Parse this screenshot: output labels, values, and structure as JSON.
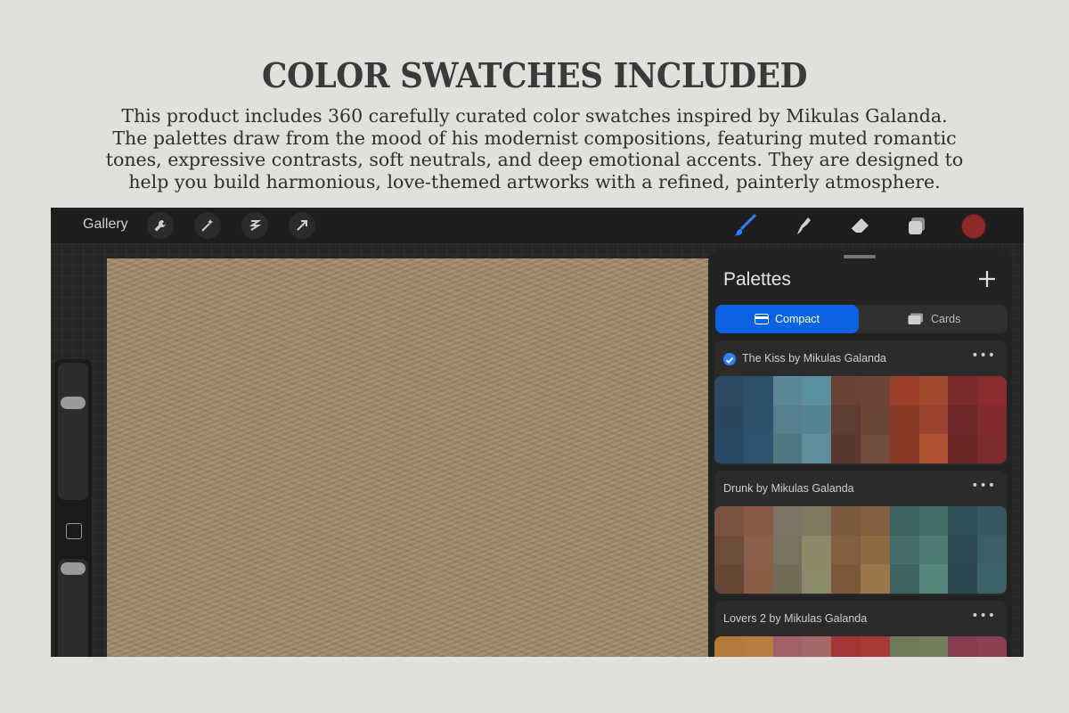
{
  "headline": "COLOR SWATCHES INCLUDED",
  "description_lines": [
    "This product includes 360 carefully curated color swatches inspired by Mikulas Galanda.",
    "The palettes draw from the mood of his modernist compositions, featuring muted romantic",
    "tones, expressive contrasts, soft neutrals, and deep emotional accents. They are designed to",
    "help you build harmonious, love-themed artworks with a refined, painterly atmosphere."
  ],
  "app": {
    "gallery_label": "Gallery",
    "toolbar_icons": [
      "wrench-icon",
      "magic-wand-icon",
      "selection-icon",
      "transform-arrow-icon"
    ],
    "right_tools": [
      "brush-icon",
      "smudge-icon",
      "eraser-icon",
      "layers-icon"
    ],
    "current_color": "#8c2a27"
  },
  "palettes_panel": {
    "title": "Palettes",
    "add_label": "+",
    "tabs": {
      "compact": "Compact",
      "cards": "Cards"
    },
    "more_label": "•••",
    "palettes": [
      {
        "name": "The Kiss by Mikulas Galanda",
        "selected": true,
        "colors": [
          "#2b4a63",
          "#2d5068",
          "#5c8895",
          "#5a909e",
          "#6a4238",
          "#6c4438",
          "#9b3f2a",
          "#a04a2e",
          "#7b2a2e",
          "#8a2c30",
          "#284861",
          "#2e526a",
          "#557f8c",
          "#54848f",
          "#5e3d34",
          "#6b4739",
          "#8c3a28",
          "#9a4430",
          "#70262a",
          "#7f2a2e",
          "#284a64",
          "#2f556e",
          "#4f7782",
          "#5f8e9a",
          "#5a3830",
          "#6f4b3d",
          "#8a3a27",
          "#ad5232",
          "#6a2428",
          "#7e2b2f"
        ]
      },
      {
        "name": "Drunk by Mikulas Galanda",
        "selected": false,
        "colors": [
          "#7a5240",
          "#855a47",
          "#7e7465",
          "#807a62",
          "#7a5b3d",
          "#80603f",
          "#3e6460",
          "#436e69",
          "#2f4e55",
          "#36585e",
          "#6e4c3c",
          "#8a604a",
          "#7a7260",
          "#8c8868",
          "#82603f",
          "#8e6a45",
          "#456e68",
          "#4e7b73",
          "#2d4a50",
          "#3b5e64",
          "#674636",
          "#8b5f47",
          "#726b58",
          "#8b8a6a",
          "#7b5a3a",
          "#9b7648",
          "#3e645f",
          "#55857b",
          "#2c484f",
          "#3d6369"
        ]
      },
      {
        "name": "Lovers 2 by Mikulas Galanda",
        "selected": false,
        "colors": [
          "#b57a3c",
          "#b87d3e",
          "#a16065",
          "#a36768",
          "#a33534",
          "#a63a36",
          "#6e7a5a",
          "#727e5c",
          "#8a3c4f",
          "#8d4052"
        ]
      }
    ]
  }
}
